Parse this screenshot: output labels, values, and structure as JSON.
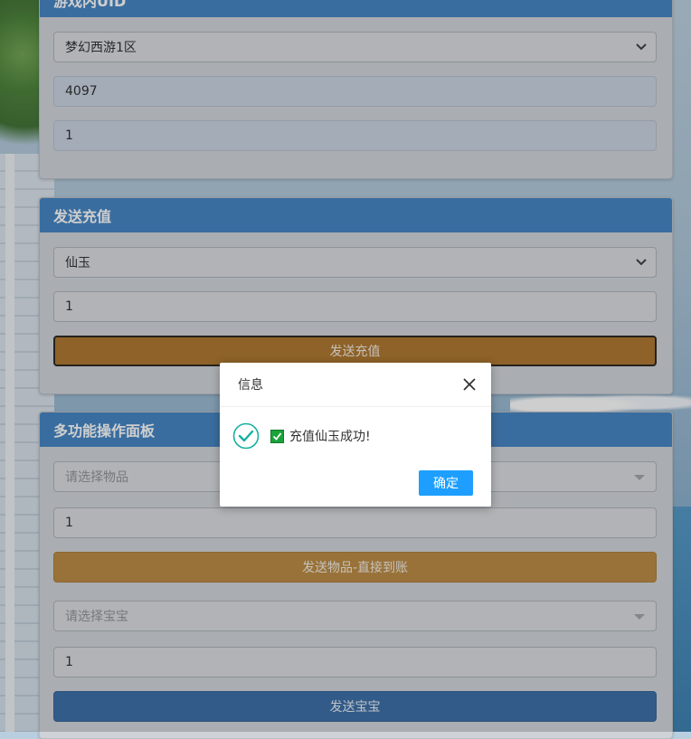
{
  "panel1": {
    "title": "游戏内UID",
    "server_select": "梦幻西游1区",
    "uid_value": "4097",
    "second_value": "1"
  },
  "panel2": {
    "title": "发送充值",
    "currency_select": "仙玉",
    "amount_value": "1",
    "submit_label": "发送充值"
  },
  "panel3": {
    "title": "多功能操作面板",
    "item_placeholder": "请选择物品",
    "item_qty": "1",
    "send_item_label": "发送物品-直接到账",
    "pet_placeholder": "请选择宝宝",
    "pet_qty": "1",
    "send_pet_label": "发送宝宝"
  },
  "modal": {
    "title": "信息",
    "message": "充值仙玉成功!",
    "confirm_label": "确定"
  },
  "icons": {
    "close": "close-icon",
    "success": "success-check-icon",
    "checkbox": "checked-box-icon",
    "chevron": "chevron-down-icon"
  },
  "colors": {
    "panel_header": "#3a7ec0",
    "recharge_button": "#aa6f22",
    "send_item_button": "#b98538",
    "send_pet_button": "#2f66a3",
    "confirm_button": "#1e9fff",
    "success_icon": "#16b0a0"
  }
}
